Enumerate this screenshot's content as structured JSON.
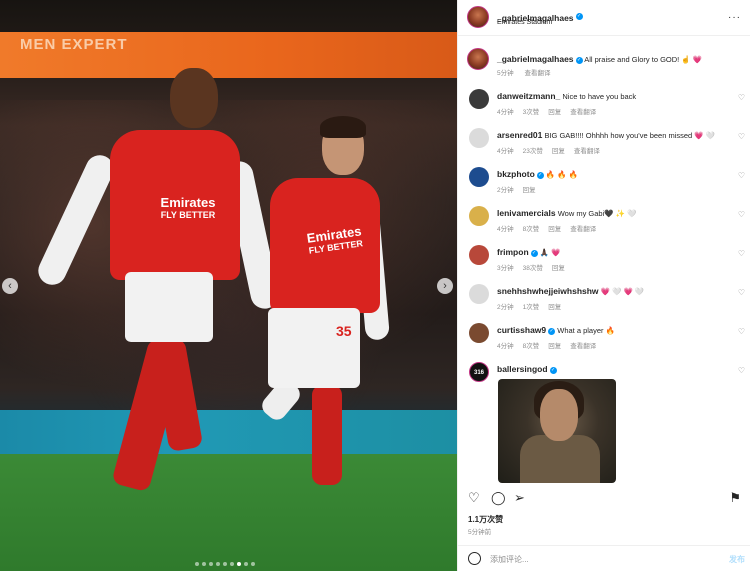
{
  "post": {
    "username": "_gabrielmagalhaes",
    "location": "Emirates Stadium",
    "caption_user": "_gabrielmagalhaes",
    "caption_text": "All praise and Glory to GOD! ☝️ 💗",
    "caption_time": "5分钟",
    "caption_translate": "查看翻译",
    "photo": {
      "banner_text": "MEN EXPERT",
      "shirt_sponsor_line1": "Emirates",
      "shirt_sponsor_line2": "FLY BETTER",
      "player2_number": "35"
    }
  },
  "comments": [
    {
      "user": "danweitzmann_",
      "verified": false,
      "text": "Nice to have you back",
      "time": "4分钟",
      "likes": "3次赞",
      "reply": "回复",
      "translate": "查看翻译",
      "avatar_color": "#3a3a3a"
    },
    {
      "user": "arsenred01",
      "verified": false,
      "text": "BIG GAB!!!! Ohhhh how you've been missed 💗 🤍",
      "time": "4分钟",
      "likes": "23次赞",
      "reply": "回复",
      "translate": "查看翻译",
      "avatar_color": "#dbdbdb"
    },
    {
      "user": "bkzphoto",
      "verified": true,
      "text": "🔥 🔥 🔥",
      "time": "2分钟",
      "likes": "",
      "reply": "回复",
      "translate": "",
      "avatar_color": "#1d4c8f"
    },
    {
      "user": "lenivamercials",
      "verified": false,
      "text": "Wow my Gabi🖤 ✨ 🤍",
      "time": "4分钟",
      "likes": "8次赞",
      "reply": "回复",
      "translate": "查看翻译",
      "avatar_color": "#d9b04a"
    },
    {
      "user": "frimpon",
      "verified": true,
      "text": "🙏🏿 💗",
      "time": "3分钟",
      "likes": "38次赞",
      "reply": "回复",
      "translate": "",
      "avatar_color": "#b8483a"
    },
    {
      "user": "snehhshwhejjeiwhshshw",
      "verified": false,
      "text": "💗 🤍 💗 🤍",
      "time": "2分钟",
      "likes": "1次赞",
      "reply": "回复",
      "translate": "",
      "avatar_color": "#dbdbdb"
    },
    {
      "user": "curtisshaw9",
      "verified": true,
      "text": "What a player 🔥",
      "time": "4分钟",
      "likes": "8次赞",
      "reply": "回复",
      "translate": "查看翻译",
      "avatar_color": "#7a4a30"
    },
    {
      "user": "ballersingod",
      "verified": true,
      "text": "",
      "time": "",
      "likes": "",
      "reply": "",
      "translate": "",
      "avatar_color": "#111111",
      "avatar_text": "316"
    }
  ],
  "footer": {
    "likes": "1.1万次赞",
    "time": "5分钟前",
    "add_comment_placeholder": "添加评论...",
    "post_label": "发布"
  },
  "colors": {
    "accent_blue": "#0095f6",
    "banner_orange": "#f07a2a",
    "arsenal_red": "#d9231f",
    "heart_red": "#ed4956"
  }
}
